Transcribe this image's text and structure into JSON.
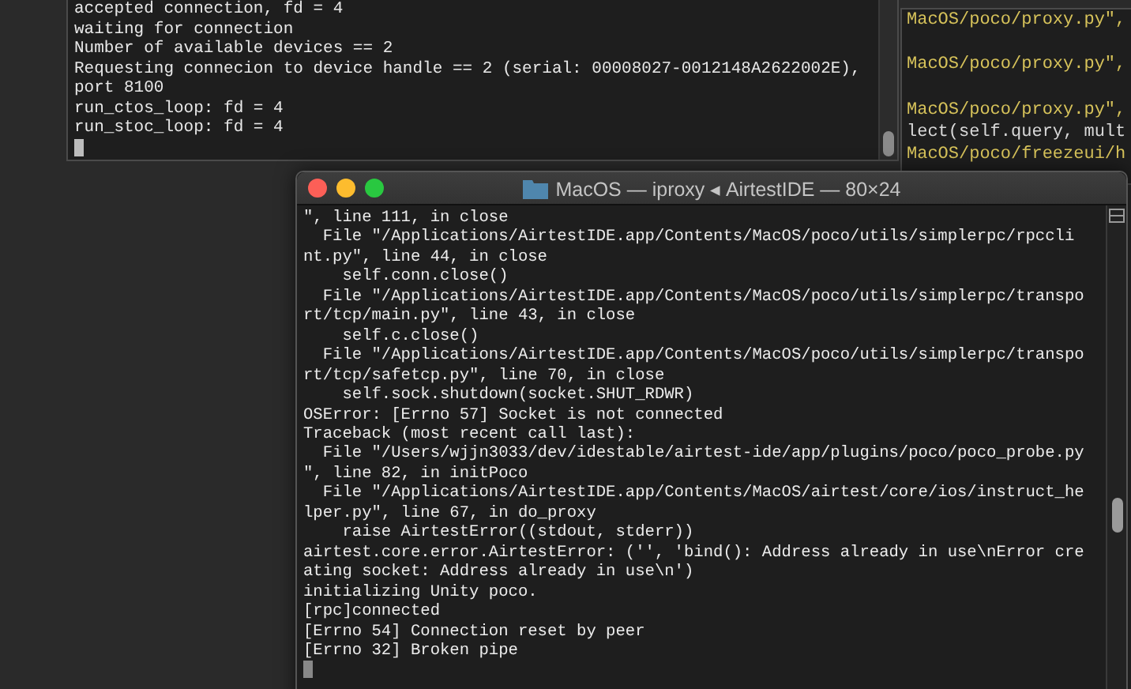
{
  "background_terminal": {
    "lines": [
      "accepted connection, fd = 4",
      "waiting for connection",
      "Number of available devices == 2",
      "Requesting connecion to device handle == 2 (serial: 00008027-0012148A2622002E),",
      "port 8100",
      "run_ctos_loop: fd = 4",
      "run_stoc_loop: fd = 4"
    ]
  },
  "side_editor": {
    "blocks": [
      [
        {
          "text": "MacOS/poco/proxy.py\",",
          "kind": "path"
        }
      ],
      [
        {
          "text": "MacOS/poco/proxy.py\",",
          "kind": "path"
        }
      ],
      [
        {
          "text": "MacOS/poco/proxy.py\",",
          "kind": "path"
        },
        {
          "text": "lect(self.query, mult",
          "kind": "code"
        },
        {
          "text": "MacOS/poco/freezeui/h",
          "kind": "path"
        }
      ]
    ]
  },
  "terminal": {
    "title": "MacOS — iproxy ◂ AirtestIDE — 80×24",
    "lines": [
      "\", line 111, in close",
      "  File \"/Applications/AirtestIDE.app/Contents/MacOS/poco/utils/simplerpc/rpccli",
      "nt.py\", line 44, in close",
      "    self.conn.close()",
      "  File \"/Applications/AirtestIDE.app/Contents/MacOS/poco/utils/simplerpc/transpo",
      "rt/tcp/main.py\", line 43, in close",
      "    self.c.close()",
      "  File \"/Applications/AirtestIDE.app/Contents/MacOS/poco/utils/simplerpc/transpo",
      "rt/tcp/safetcp.py\", line 70, in close",
      "    self.sock.shutdown(socket.SHUT_RDWR)",
      "OSError: [Errno 57] Socket is not connected",
      "Traceback (most recent call last):",
      "  File \"/Users/wjjn3033/dev/idestable/airtest-ide/app/plugins/poco/poco_probe.py",
      "\", line 82, in initPoco",
      "  File \"/Applications/AirtestIDE.app/Contents/MacOS/airtest/core/ios/instruct_he",
      "lper.py\", line 67, in do_proxy",
      "    raise AirtestError((stdout, stderr))",
      "airtest.core.error.AirtestError: ('', 'bind(): Address already in use\\nError cre",
      "ating socket: Address already in use\\n')",
      "initializing Unity poco.",
      "[rpc]connected",
      "[Errno 54] Connection reset by peer",
      "[Errno 32] Broken pipe"
    ]
  }
}
